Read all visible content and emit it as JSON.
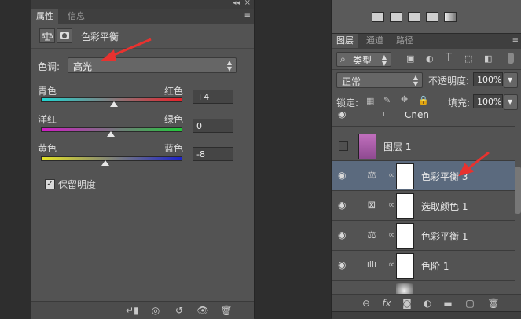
{
  "properties": {
    "tabs": [
      "属性",
      "信息"
    ],
    "panel_title": "色彩平衡",
    "tone": {
      "label": "色调:",
      "value": "高光"
    },
    "sliders": [
      {
        "left": "青色",
        "right": "红色",
        "value": "+4",
        "level": 0.52,
        "gradient": [
          "#1fd7d3",
          "#e8222a"
        ]
      },
      {
        "left": "洋红",
        "right": "绿色",
        "value": "0",
        "level": 0.5,
        "gradient": [
          "#d11cc6",
          "#22c93a"
        ]
      },
      {
        "left": "黄色",
        "right": "蓝色",
        "value": "-8",
        "level": 0.46,
        "gradient": [
          "#e4e326",
          "#1d23c9"
        ]
      }
    ],
    "preserve_luminosity": {
      "label": "保留明度",
      "checked": true
    }
  },
  "layers_panel": {
    "tabs": [
      "图层",
      "通道",
      "路径"
    ],
    "filter": {
      "label": "类型"
    },
    "blend_mode": "正常",
    "opacity": {
      "label": "不透明度:",
      "value": "100%"
    },
    "lock": {
      "label": "锁定:"
    },
    "fill": {
      "label": "填充:",
      "value": "100%"
    },
    "items": [
      {
        "name": "Chen",
        "type": "text",
        "visible": true
      },
      {
        "name": "图层 1",
        "type": "pixel",
        "visible": false
      },
      {
        "name": "色彩平衡 3",
        "type": "color-balance",
        "visible": true,
        "selected": true
      },
      {
        "name": "选取颜色 1",
        "type": "selective-color",
        "visible": true
      },
      {
        "name": "色彩平衡 1",
        "type": "color-balance",
        "visible": true
      },
      {
        "name": "色阶 1",
        "type": "levels",
        "visible": true
      }
    ]
  },
  "colors": {
    "panel_bg": "#535353",
    "selected_layer": "#5b6a7e",
    "annotation_arrow": "#e8322f"
  }
}
